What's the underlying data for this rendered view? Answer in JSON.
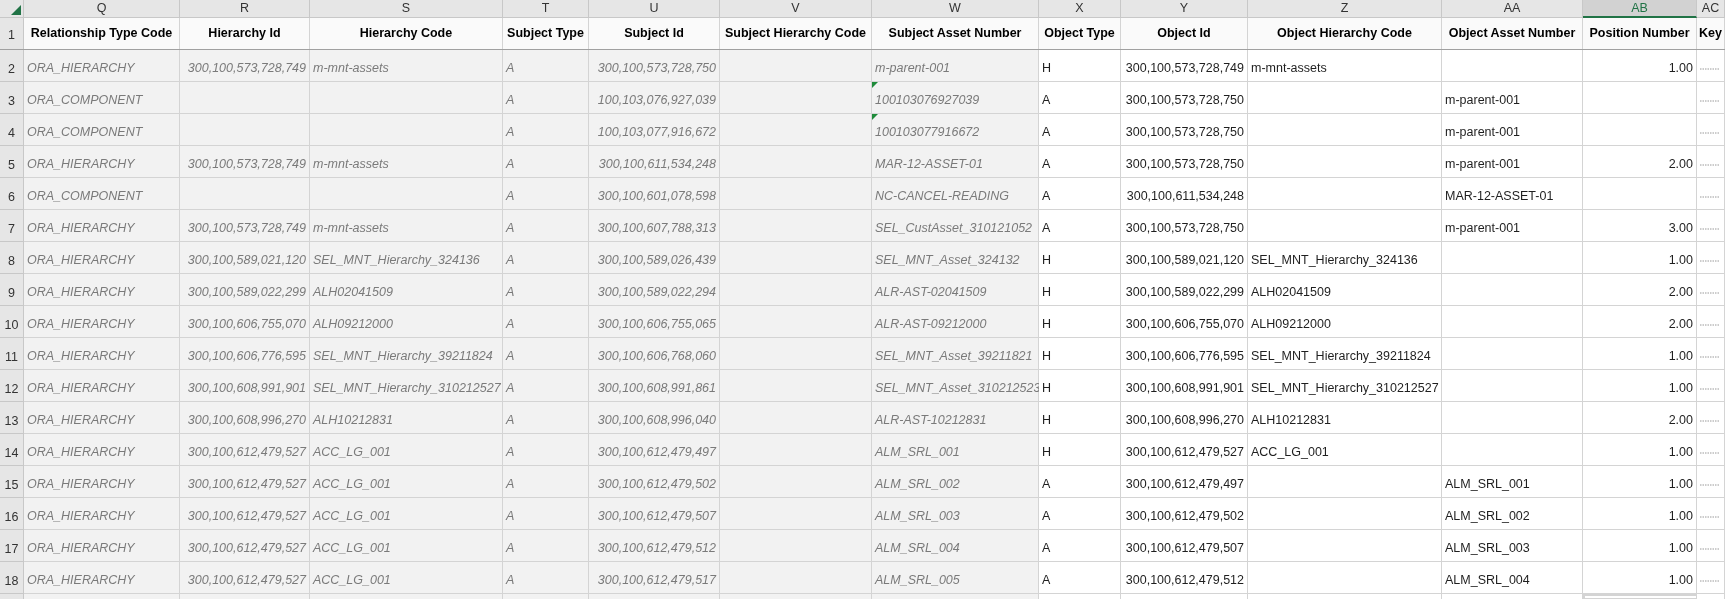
{
  "columns": [
    {
      "letter": "Q",
      "header": "Relationship Type Code",
      "selected": false,
      "locked": true,
      "numeric": false
    },
    {
      "letter": "R",
      "header": "Hierarchy Id",
      "selected": false,
      "locked": true,
      "numeric": true
    },
    {
      "letter": "S",
      "header": "Hierarchy Code",
      "selected": false,
      "locked": true,
      "numeric": false
    },
    {
      "letter": "T",
      "header": "Subject Type",
      "selected": false,
      "locked": true,
      "numeric": false
    },
    {
      "letter": "U",
      "header": "Subject Id",
      "selected": false,
      "locked": true,
      "numeric": true
    },
    {
      "letter": "V",
      "header": "Subject Hierarchy Code",
      "selected": false,
      "locked": true,
      "numeric": false
    },
    {
      "letter": "W",
      "header": "Subject Asset Number",
      "selected": false,
      "locked": true,
      "numeric": false
    },
    {
      "letter": "X",
      "header": "Object Type",
      "selected": false,
      "locked": false,
      "numeric": false
    },
    {
      "letter": "Y",
      "header": "Object Id",
      "selected": false,
      "locked": false,
      "numeric": true
    },
    {
      "letter": "Z",
      "header": "Object Hierarchy Code",
      "selected": false,
      "locked": false,
      "numeric": false
    },
    {
      "letter": "AA",
      "header": "Object Asset Number",
      "selected": false,
      "locked": false,
      "numeric": false
    },
    {
      "letter": "AB",
      "header": "Position Number",
      "selected": true,
      "locked": false,
      "numeric": true
    },
    {
      "letter": "AC",
      "header": "Key",
      "selected": false,
      "locked": false,
      "numeric": false
    }
  ],
  "header_row": "1",
  "rows": [
    {
      "number": "2",
      "text_flag": false,
      "key_overflow": true,
      "cells": [
        "ORA_HIERARCHY",
        "300,100,573,728,749",
        "m-mnt-assets",
        "A",
        "300,100,573,728,750",
        null,
        "m-parent-001",
        "H",
        "300,100,573,728,749",
        "m-mnt-assets",
        null,
        "1.00"
      ]
    },
    {
      "number": "3",
      "text_flag": true,
      "key_overflow": true,
      "cells": [
        "ORA_COMPONENT",
        null,
        null,
        "A",
        "100,103,076,927,039",
        null,
        "100103076927039",
        "A",
        "300,100,573,728,750",
        null,
        "m-parent-001",
        null
      ]
    },
    {
      "number": "4",
      "text_flag": true,
      "key_overflow": true,
      "cells": [
        "ORA_COMPONENT",
        null,
        null,
        "A",
        "100,103,077,916,672",
        null,
        "100103077916672",
        "A",
        "300,100,573,728,750",
        null,
        "m-parent-001",
        null
      ]
    },
    {
      "number": "5",
      "text_flag": false,
      "key_overflow": true,
      "cells": [
        "ORA_HIERARCHY",
        "300,100,573,728,749",
        "m-mnt-assets",
        "A",
        "300,100,611,534,248",
        null,
        "MAR-12-ASSET-01",
        "A",
        "300,100,573,728,750",
        null,
        "m-parent-001",
        "2.00"
      ]
    },
    {
      "number": "6",
      "text_flag": false,
      "key_overflow": true,
      "cells": [
        "ORA_COMPONENT",
        null,
        null,
        "A",
        "300,100,601,078,598",
        null,
        "NC-CANCEL-READING",
        "A",
        "300,100,611,534,248",
        null,
        "MAR-12-ASSET-01",
        null
      ]
    },
    {
      "number": "7",
      "text_flag": false,
      "key_overflow": true,
      "cells": [
        "ORA_HIERARCHY",
        "300,100,573,728,749",
        "m-mnt-assets",
        "A",
        "300,100,607,788,313",
        null,
        "SEL_CustAsset_310121052",
        "A",
        "300,100,573,728,750",
        null,
        "m-parent-001",
        "3.00"
      ]
    },
    {
      "number": "8",
      "text_flag": false,
      "key_overflow": true,
      "cells": [
        "ORA_HIERARCHY",
        "300,100,589,021,120",
        "SEL_MNT_Hierarchy_324136",
        "A",
        "300,100,589,026,439",
        null,
        "SEL_MNT_Asset_324132",
        "H",
        "300,100,589,021,120",
        "SEL_MNT_Hierarchy_324136",
        null,
        "1.00"
      ]
    },
    {
      "number": "9",
      "text_flag": false,
      "key_overflow": true,
      "cells": [
        "ORA_HIERARCHY",
        "300,100,589,022,299",
        "ALH02041509",
        "A",
        "300,100,589,022,294",
        null,
        "ALR-AST-02041509",
        "H",
        "300,100,589,022,299",
        "ALH02041509",
        null,
        "2.00"
      ]
    },
    {
      "number": "10",
      "text_flag": false,
      "key_overflow": true,
      "cells": [
        "ORA_HIERARCHY",
        "300,100,606,755,070",
        "ALH09212000",
        "A",
        "300,100,606,755,065",
        null,
        "ALR-AST-09212000",
        "H",
        "300,100,606,755,070",
        "ALH09212000",
        null,
        "2.00"
      ]
    },
    {
      "number": "11",
      "text_flag": false,
      "key_overflow": true,
      "cells": [
        "ORA_HIERARCHY",
        "300,100,606,776,595",
        "SEL_MNT_Hierarchy_39211824",
        "A",
        "300,100,606,768,060",
        null,
        "SEL_MNT_Asset_39211821",
        "H",
        "300,100,606,776,595",
        "SEL_MNT_Hierarchy_39211824",
        null,
        "1.00"
      ]
    },
    {
      "number": "12",
      "text_flag": false,
      "key_overflow": true,
      "cells": [
        "ORA_HIERARCHY",
        "300,100,608,991,901",
        "SEL_MNT_Hierarchy_310212527",
        "A",
        "300,100,608,991,861",
        null,
        "SEL_MNT_Asset_310212523",
        "H",
        "300,100,608,991,901",
        "SEL_MNT_Hierarchy_310212527",
        null,
        "1.00"
      ]
    },
    {
      "number": "13",
      "text_flag": false,
      "key_overflow": true,
      "cells": [
        "ORA_HIERARCHY",
        "300,100,608,996,270",
        "ALH10212831",
        "A",
        "300,100,608,996,040",
        null,
        "ALR-AST-10212831",
        "H",
        "300,100,608,996,270",
        "ALH10212831",
        null,
        "2.00"
      ]
    },
    {
      "number": "14",
      "text_flag": false,
      "key_overflow": true,
      "cells": [
        "ORA_HIERARCHY",
        "300,100,612,479,527",
        "ACC_LG_001",
        "A",
        "300,100,612,479,497",
        null,
        "ALM_SRL_001",
        "H",
        "300,100,612,479,527",
        "ACC_LG_001",
        null,
        "1.00"
      ]
    },
    {
      "number": "15",
      "text_flag": false,
      "key_overflow": true,
      "cells": [
        "ORA_HIERARCHY",
        "300,100,612,479,527",
        "ACC_LG_001",
        "A",
        "300,100,612,479,502",
        null,
        "ALM_SRL_002",
        "A",
        "300,100,612,479,497",
        null,
        "ALM_SRL_001",
        "1.00"
      ]
    },
    {
      "number": "16",
      "text_flag": false,
      "key_overflow": true,
      "cells": [
        "ORA_HIERARCHY",
        "300,100,612,479,527",
        "ACC_LG_001",
        "A",
        "300,100,612,479,507",
        null,
        "ALM_SRL_003",
        "A",
        "300,100,612,479,502",
        null,
        "ALM_SRL_002",
        "1.00"
      ]
    },
    {
      "number": "17",
      "text_flag": false,
      "key_overflow": true,
      "cells": [
        "ORA_HIERARCHY",
        "300,100,612,479,527",
        "ACC_LG_001",
        "A",
        "300,100,612,479,512",
        null,
        "ALM_SRL_004",
        "A",
        "300,100,612,479,507",
        null,
        "ALM_SRL_003",
        "1.00"
      ]
    },
    {
      "number": "18",
      "text_flag": false,
      "key_overflow": true,
      "cells": [
        "ORA_HIERARCHY",
        "300,100,612,479,527",
        "ACC_LG_001",
        "A",
        "300,100,612,479,517",
        null,
        "ALM_SRL_005",
        "A",
        "300,100,612,479,512",
        null,
        "ALM_SRL_004",
        "1.00"
      ]
    }
  ]
}
